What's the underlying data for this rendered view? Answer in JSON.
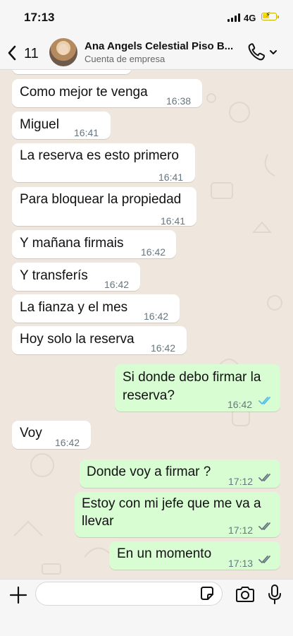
{
  "status_bar": {
    "time": "17:13",
    "network": "4G",
    "icons": [
      "signal-icon",
      "battery-charging-icon"
    ]
  },
  "header": {
    "back_count": "11",
    "contact_name": "Ana Angels Celestial Piso B...",
    "subtitle": "Cuenta de empresa",
    "icons": [
      "back-chevron-icon",
      "phone-icon",
      "chevron-down-icon"
    ]
  },
  "messages": [
    {
      "direction": "in",
      "text": "Como mejor te venga",
      "time": "16:38"
    },
    {
      "direction": "in",
      "text": "Miguel",
      "time": "16:41"
    },
    {
      "direction": "in",
      "text": "La reserva es esto primero",
      "time": "16:41"
    },
    {
      "direction": "in",
      "text": "Para bloquear la propiedad",
      "time": "16:41"
    },
    {
      "direction": "in",
      "text": "Y mañana firmais",
      "time": "16:42"
    },
    {
      "direction": "in",
      "text": "Y transferís",
      "time": "16:42"
    },
    {
      "direction": "in",
      "text": "La fianza y el mes",
      "time": "16:42"
    },
    {
      "direction": "in",
      "text": "Hoy solo la reserva",
      "time": "16:42"
    },
    {
      "direction": "out",
      "lines": [
        "Si donde debo firmar la",
        "reserva?"
      ],
      "time": "16:42",
      "status": "read"
    },
    {
      "direction": "in",
      "text": "Voy",
      "time": "16:42"
    },
    {
      "direction": "out",
      "text": "Donde voy a firmar ?",
      "time": "17:12",
      "status": "delivered"
    },
    {
      "direction": "out",
      "lines": [
        "Estoy con mi jefe que me va a",
        "llevar"
      ],
      "time": "17:12",
      "status": "delivered"
    },
    {
      "direction": "out",
      "text": "En un momento",
      "time": "17:13",
      "status": "delivered"
    }
  ],
  "input_bar": {
    "placeholder": "",
    "icons": [
      "plus-icon",
      "sticker-icon",
      "camera-icon",
      "microphone-icon"
    ]
  },
  "colors": {
    "incoming_bubble": "#ffffff",
    "outgoing_bubble": "#d9fdd3",
    "read_ticks": "#53bdeb",
    "delivered_ticks": "#667781",
    "chat_background": "#efe7dd"
  }
}
